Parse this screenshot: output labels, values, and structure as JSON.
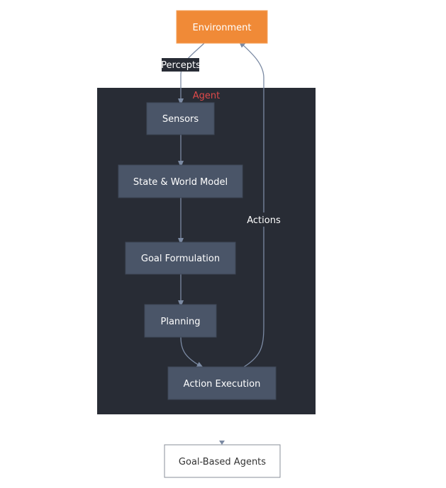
{
  "diagram": {
    "cluster": {
      "title": "Agent",
      "title_color": "#e04a4a",
      "fill": "#282c35"
    },
    "nodes": {
      "environment": {
        "label": "Environment",
        "fill": "#f08a37"
      },
      "sensors": {
        "label": "Sensors",
        "fill": "#4a5568"
      },
      "state": {
        "label": "State & World Model",
        "fill": "#4a5568"
      },
      "goal": {
        "label": "Goal Formulation",
        "fill": "#4a5568"
      },
      "planning": {
        "label": "Planning",
        "fill": "#4a5568"
      },
      "action": {
        "label": "Action Execution",
        "fill": "#4a5568"
      }
    },
    "edges": [
      {
        "from": "environment",
        "to": "sensors",
        "label": "Percepts"
      },
      {
        "from": "sensors",
        "to": "state",
        "label": ""
      },
      {
        "from": "state",
        "to": "goal",
        "label": ""
      },
      {
        "from": "goal",
        "to": "planning",
        "label": ""
      },
      {
        "from": "planning",
        "to": "action",
        "label": ""
      },
      {
        "from": "action",
        "to": "environment",
        "label": "Actions"
      }
    ],
    "caption": "Goal-Based Agents",
    "edge_color": "#7b8aa3"
  }
}
